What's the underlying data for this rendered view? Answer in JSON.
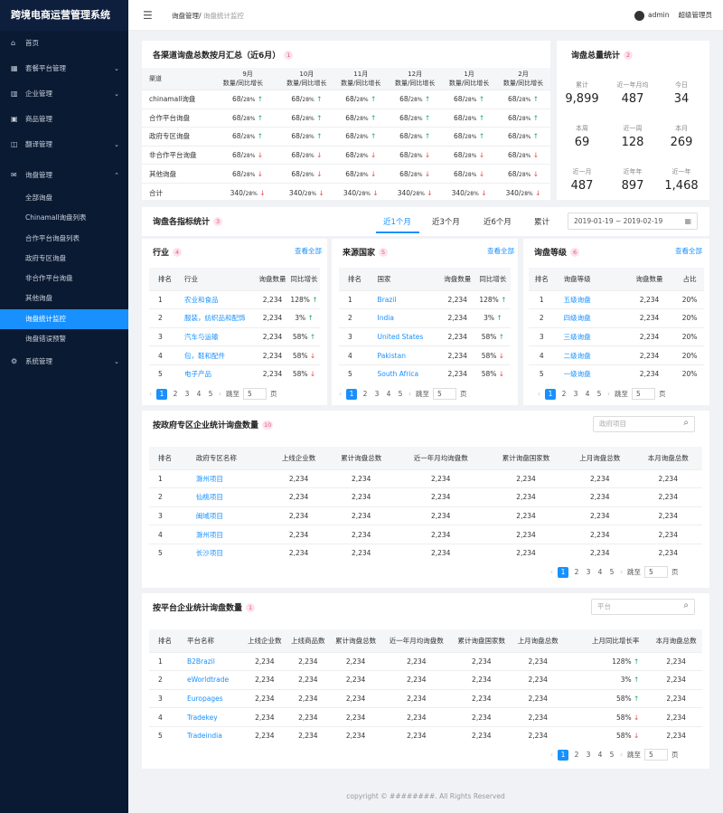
{
  "app_title": "跨境电商运营管理系统",
  "menu": [
    {
      "icon": "home-icon",
      "label": "首页"
    },
    {
      "icon": "grid-icon",
      "label": "套餐平台管理",
      "expand": "chevron-down-icon"
    },
    {
      "icon": "building-icon",
      "label": "企业管理",
      "expand": "chevron-down-icon"
    },
    {
      "icon": "box-icon",
      "label": "商品管理"
    },
    {
      "icon": "translate-icon",
      "label": "翻译管理",
      "expand": "chevron-down-icon"
    }
  ],
  "inquiry_menu": {
    "icon": "inquiry-icon",
    "label": "询盘管理",
    "expand": "chevron-up-icon",
    "items": [
      "全部询盘",
      "Chinamall询盘列表",
      "合作平台询盘列表",
      "政府专区询盘",
      "非合作平台询盘",
      "其他询盘",
      "询盘统计监控",
      "询盘错误预警"
    ]
  },
  "system_menu": {
    "icon": "gear-icon",
    "label": "系统管理",
    "expand": "chevron-down-icon"
  },
  "header": {
    "menu_icon": "hamburger-icon",
    "crumb_parent": "询盘管理",
    "crumb_sep": "/",
    "crumb_current": "询盘统计监控",
    "user": "admin",
    "role": "超级管理员"
  },
  "summary": {
    "title": "各渠道询盘总数按月汇总（近6月）",
    "badge": "1",
    "channel_header": "渠道",
    "months": [
      "9月",
      "10月",
      "11月",
      "12月",
      "1月",
      "2月"
    ],
    "subheader": "数量/同比增长",
    "rows": [
      {
        "name": "chinamall询盘",
        "vals": [
          "68/",
          "28%",
          "up"
        ]
      },
      {
        "name": "合作平台询盘",
        "vals": [
          "68/",
          "28%",
          "up"
        ]
      },
      {
        "name": "政府专区询盘",
        "vals": [
          "68/",
          "28%",
          "up"
        ]
      },
      {
        "name": "非合作平台询盘",
        "vals": [
          "68/",
          "28%",
          "down"
        ]
      },
      {
        "name": "其他询盘",
        "vals": [
          "68/",
          "28%",
          "down"
        ]
      },
      {
        "name": "合计",
        "vals": [
          "340/",
          "28%",
          "down"
        ]
      }
    ]
  },
  "totals": {
    "title": "询盘总量统计",
    "badge": "2",
    "stats": [
      {
        "label": "累计",
        "value": "9,899"
      },
      {
        "label": "近一年月均",
        "value": "487"
      },
      {
        "label": "今日",
        "value": "34"
      },
      {
        "label": "本周",
        "value": "69"
      },
      {
        "label": "近一周",
        "value": "128"
      },
      {
        "label": "本月",
        "value": "269"
      },
      {
        "label": "近一月",
        "value": "487"
      },
      {
        "label": "近年年",
        "value": "897"
      },
      {
        "label": "近一年",
        "value": "1,468"
      }
    ]
  },
  "indicators": {
    "title": "询盘各指标统计",
    "badge": "3",
    "tabs": [
      "近1个月",
      "近3个月",
      "近6个月",
      "累计"
    ],
    "date_range": "2019-01-19 ~ 2019-02-19",
    "calendar_icon": "calendar-icon"
  },
  "industry": {
    "title": "行业",
    "badge": "4",
    "more": "查看全部",
    "headers": [
      "排名",
      "行业",
      "询盘数量",
      "同比增长"
    ],
    "rows": [
      [
        "1",
        "农业和食品",
        "2,234",
        "128%",
        "up"
      ],
      [
        "2",
        "服装，纺织品和配饰",
        "2,234",
        "3%",
        "up"
      ],
      [
        "3",
        "汽车与运输",
        "2,234",
        "58%",
        "up"
      ],
      [
        "4",
        "包，鞋和配件",
        "2,234",
        "58%",
        "down"
      ],
      [
        "5",
        "电子产品",
        "2,234",
        "58%",
        "down"
      ]
    ]
  },
  "country": {
    "title": "来源国家",
    "badge": "5",
    "more": "查看全部",
    "headers": [
      "排名",
      "国家",
      "询盘数量",
      "同比增长"
    ],
    "rows": [
      [
        "1",
        "Brazil",
        "2,234",
        "128%",
        "up"
      ],
      [
        "2",
        "India",
        "2,234",
        "3%",
        "up"
      ],
      [
        "3",
        "United States",
        "2,234",
        "58%",
        "up"
      ],
      [
        "4",
        "Pakistan",
        "2,234",
        "58%",
        "down"
      ],
      [
        "5",
        "South Africa",
        "2,234",
        "58%",
        "down"
      ]
    ]
  },
  "grade": {
    "title": "询盘等级",
    "badge": "6",
    "more": "查看全部",
    "headers": [
      "排名",
      "询盘等级",
      "询盘数量",
      "占比"
    ],
    "rows": [
      [
        "1",
        "五级询盘",
        "2,234",
        "20%"
      ],
      [
        "2",
        "四级询盘",
        "2,234",
        "20%"
      ],
      [
        "3",
        "三级询盘",
        "2,234",
        "20%"
      ],
      [
        "4",
        "二级询盘",
        "2,234",
        "20%"
      ],
      [
        "5",
        "一级询盘",
        "2,234",
        "20%"
      ]
    ]
  },
  "pager": {
    "pages": [
      "1",
      "2",
      "3",
      "4",
      "5"
    ],
    "jump_label": "跳至",
    "jump_value": "5",
    "page_label": "页",
    "prev": "‹",
    "next": "›"
  },
  "gov": {
    "title": "按政府专区企业统计询盘数量",
    "badge": "10",
    "search_placeholder": "政府项目",
    "headers": [
      "排名",
      "政府专区名称",
      "上线企业数",
      "累计询盘总数",
      "近一年月均询盘数",
      "累计询盘国家数",
      "上月询盘总数",
      "本月询盘总数"
    ],
    "rows": [
      [
        "1",
        "滁州项目",
        "2,234",
        "2,234",
        "2,234",
        "2,234",
        "2,234",
        "2,234"
      ],
      [
        "2",
        "仙桃项目",
        "2,234",
        "2,234",
        "2,234",
        "2,234",
        "2,234",
        "2,234"
      ],
      [
        "3",
        "闽域项目",
        "2,234",
        "2,234",
        "2,234",
        "2,234",
        "2,234",
        "2,234"
      ],
      [
        "4",
        "滁州项目",
        "2,234",
        "2,234",
        "2,234",
        "2,234",
        "2,234",
        "2,234"
      ],
      [
        "5",
        "长沙项目",
        "2,234",
        "2,234",
        "2,234",
        "2,234",
        "2,234",
        "2,234"
      ]
    ]
  },
  "platform": {
    "title": "按平台企业统计询盘数量",
    "badge": "1",
    "search_placeholder": "平台",
    "headers": [
      "排名",
      "平台名称",
      "上线企业数",
      "上线商品数",
      "累计询盘总数",
      "近一年月均询盘数",
      "累计询盘国家数",
      "上月询盘总数",
      "上月同比增长率",
      "本月询盘总数"
    ],
    "rows": [
      [
        "1",
        "B2Brazil",
        "2,234",
        "2,234",
        "2,234",
        "2,234",
        "2,234",
        "2,234",
        "128%",
        "up",
        "2,234"
      ],
      [
        "2",
        "eWorldtrade",
        "2,234",
        "2,234",
        "2,234",
        "2,234",
        "2,234",
        "2,234",
        "3%",
        "up",
        "2,234"
      ],
      [
        "3",
        "Europages",
        "2,234",
        "2,234",
        "2,234",
        "2,234",
        "2,234",
        "2,234",
        "58%",
        "up",
        "2,234"
      ],
      [
        "4",
        "Tradekey",
        "2,234",
        "2,234",
        "2,234",
        "2,234",
        "2,234",
        "2,234",
        "58%",
        "down",
        "2,234"
      ],
      [
        "5",
        "Tradeindia",
        "2,234",
        "2,234",
        "2,234",
        "2,234",
        "2,234",
        "2,234",
        "58%",
        "down",
        "2,234"
      ]
    ]
  },
  "footer": "copyright  © ########. All Rights Reserved",
  "colors": {
    "sidebar": "#0b1a33",
    "accent": "#1890ff",
    "up": "#19a65b",
    "down": "#e84848",
    "badge_bg": "#fde2ec"
  }
}
